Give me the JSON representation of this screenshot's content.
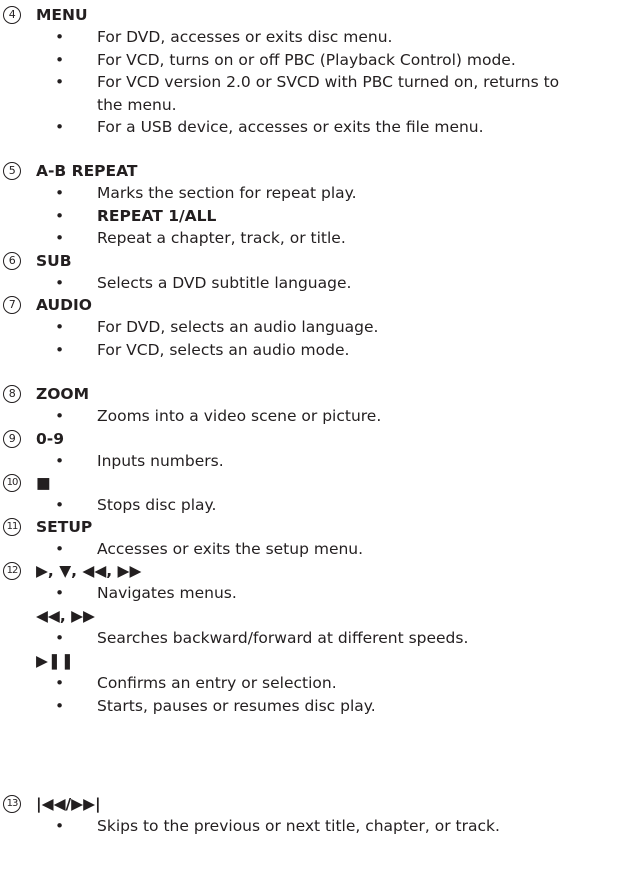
{
  "items": [
    {
      "num": "4",
      "title": "MENU",
      "lines": [
        {
          "b": true,
          "t": "For DVD, accesses or exits disc menu."
        },
        {
          "b": true,
          "t": "For VCD, turns on or off PBC (Playback Control) mode."
        },
        {
          "b": true,
          "t": "For VCD version 2.0 or SVCD with PBC turned on, returns to"
        },
        {
          "b": false,
          "t": "the menu."
        },
        {
          "b": true,
          "t": "For a USB device, accesses or exits the file menu."
        }
      ]
    },
    {
      "num": "5",
      "title": "A-B REPEAT",
      "lines": [
        {
          "b": true,
          "t": "Marks the section for repeat play."
        },
        {
          "b": true,
          "bold": true,
          "t": "REPEAT 1/ALL"
        },
        {
          "b": true,
          "t": "Repeat a chapter, track, or title."
        }
      ]
    },
    {
      "num": "6",
      "title": "SUB",
      "lines": [
        {
          "b": true,
          "t": "Selects a DVD subtitle language."
        }
      ]
    },
    {
      "num": "7",
      "title": "AUDIO",
      "lines": [
        {
          "b": true,
          "t": "For DVD, selects an audio language."
        },
        {
          "b": true,
          "t": "For VCD, selects an audio mode."
        }
      ]
    },
    {
      "num": "8",
      "title": "ZOOM",
      "lines": [
        {
          "b": true,
          "t": "Zooms into a video scene or picture."
        }
      ]
    },
    {
      "num": "9",
      "title": "0-9",
      "lines": [
        {
          "b": true,
          "t": "Inputs numbers."
        }
      ]
    },
    {
      "num": "10",
      "title": "■",
      "lines": [
        {
          "b": true,
          "t": "Stops disc play."
        }
      ]
    },
    {
      "num": "11",
      "title": "SETUP",
      "lines": [
        {
          "b": true,
          "t": "Accesses or exits the setup menu."
        }
      ]
    },
    {
      "num": "12",
      "title": "▶, ▼, ◀◀, ▶▶",
      "lines": [
        {
          "b": true,
          "t": "Navigates menus."
        },
        {
          "b": false,
          "sub": true,
          "t": "◀◀, ▶▶"
        },
        {
          "b": true,
          "t": "Searches backward/forward at different speeds."
        },
        {
          "b": false,
          "sub": true,
          "t": "▶❚❚"
        },
        {
          "b": true,
          "t": "Confirms an entry or selection."
        },
        {
          "b": true,
          "t": "Starts, pauses or resumes disc play."
        }
      ]
    },
    {
      "num": "13",
      "title": "|◀◀/▶▶|",
      "lines": [
        {
          "b": true,
          "t": "Skips to the previous or next title, chapter, or track."
        }
      ]
    }
  ]
}
